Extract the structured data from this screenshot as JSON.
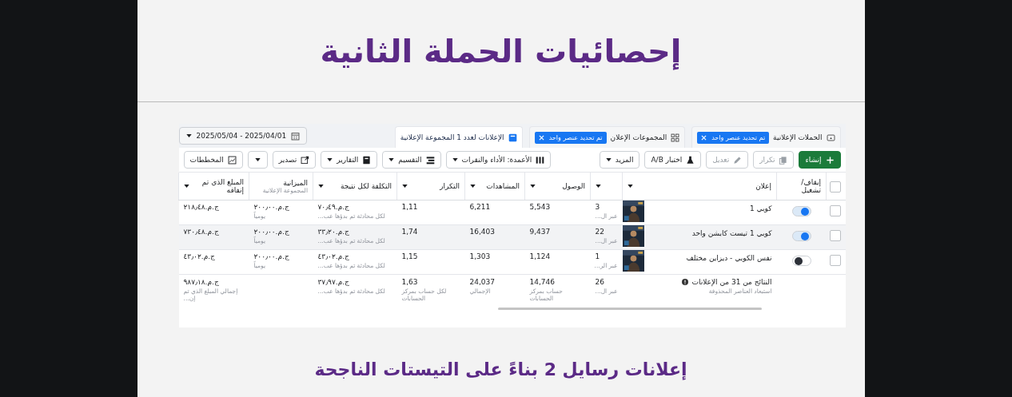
{
  "page_title": "إحصائيات الحملة الثانية",
  "tabs": [
    {
      "label": "الحملات الإعلانية",
      "selected": false,
      "chip": "تم تحديد عنصر واحد"
    },
    {
      "label": "المجموعات الإعلان",
      "selected": false,
      "chip": "تم تحديد عنصر واحد"
    },
    {
      "label": "الإعلانات لعدد 1 المجموعة الإعلانية",
      "selected": true
    }
  ],
  "date_range": "2025/05/04 - 2025/04/01",
  "toolbar": [
    {
      "label": "إنشاء",
      "kind": "primary",
      "disabled": false
    },
    {
      "label": "تكرار",
      "kind": "button",
      "disabled": true
    },
    {
      "label": "تعديل",
      "kind": "button",
      "disabled": true
    },
    {
      "label": "اختبار A/B",
      "kind": "button",
      "disabled": false
    },
    {
      "label": "المزيد",
      "kind": "dropdown",
      "disabled": false
    },
    {
      "label": "الأعمدة: الأداء والنقرات",
      "kind": "dropdown",
      "disabled": false
    },
    {
      "label": "التقسيم",
      "kind": "dropdown",
      "disabled": false
    },
    {
      "label": "التقارير",
      "kind": "dropdown",
      "disabled": false
    },
    {
      "label": "تصدير",
      "kind": "button",
      "disabled": false
    },
    {
      "kind": "caret",
      "disabled": false
    },
    {
      "label": "المخططات",
      "kind": "button",
      "disabled": false
    }
  ],
  "table": {
    "select_all_checked": false,
    "fixed_columns": [
      {
        "kind": "checkbox"
      },
      {
        "kind": "toggle",
        "label": "إيقاف/ تشغيل"
      },
      {
        "kind": "ad",
        "label": "إعلان",
        "caret": true
      }
    ],
    "columns": [
      {
        "kind": "metric",
        "caret": true
      },
      {
        "kind": "metric",
        "label": "الوصول",
        "caret": true
      },
      {
        "kind": "metric",
        "label": "المشاهدات",
        "caret": true
      },
      {
        "kind": "metric",
        "label": "التكرار",
        "caret": true
      },
      {
        "kind": "metric",
        "label": "التكلفة لكل نتيجة",
        "caret": true
      },
      {
        "kind": "metric",
        "label": "الميزانية",
        "sublabel": "المجموعة الإعلانية",
        "caret": false
      },
      {
        "kind": "metric",
        "label": "المبلغ الذي تم إنفاقه",
        "caret": true
      }
    ],
    "rows": [
      {
        "checked": false,
        "on": true,
        "hovered": false,
        "name": "كوبي 1",
        "cells": [
          {
            "value": "3",
            "note": "عبر ال..."
          },
          {
            "value": "5,543"
          },
          {
            "value": "6,211"
          },
          {
            "value": "1,11"
          },
          {
            "value": "ج.م.‏٧٠٫٤٩",
            "note": "لكل محادثة تم بدؤها عب..."
          },
          {
            "value": "ج.م.‏٢٠٠٫٠٠",
            "note": "يومياً"
          },
          {
            "value": "ج.م.‏٢١٨٫٤٨"
          }
        ]
      },
      {
        "checked": false,
        "on": true,
        "hovered": true,
        "name": "كوبي 1 تيست كابشن واحد",
        "cells": [
          {
            "value": "22",
            "note": "عبر ال..."
          },
          {
            "value": "9,437"
          },
          {
            "value": "16,403"
          },
          {
            "value": "1,74"
          },
          {
            "value": "ج.م.‏٣٣٫٢٠",
            "note": "لكل محادثة تم بدؤها عب..."
          },
          {
            "value": "ج.م.‏٢٠٠٫٠٠",
            "note": "يومياً"
          },
          {
            "value": "ج.م.‏٧٣٠٫٤٨"
          }
        ]
      },
      {
        "checked": false,
        "on": false,
        "hovered": false,
        "name": "نفس الكوبي - ديزاين مختلف",
        "cells": [
          {
            "value": "1",
            "note": "عبر الر..."
          },
          {
            "value": "1,124"
          },
          {
            "value": "1,303"
          },
          {
            "value": "1,15"
          },
          {
            "value": "ج.م.‏٤٣٫٠٢",
            "note": "لكل محادثة تم بدؤها عب..."
          },
          {
            "value": "ج.م.‏٢٠٠٫٠٠",
            "note": "يومياً"
          },
          {
            "value": "ج.م.‏٤٣٫٠٢"
          }
        ]
      }
    ],
    "summary": {
      "label": "النتائج من 31 من الإعلانات",
      "note": "استبعاد العناصر المحذوفة",
      "cells": [
        {
          "value": "26",
          "note": "عبر ال..."
        },
        {
          "value": "14,746",
          "note": "حساب بمركز الحسابات"
        },
        {
          "value": "24,037",
          "note": "الإجمالي"
        },
        {
          "value": "1,63",
          "note": "لكل حساب بمركز الحسابات"
        },
        {
          "value": "ج.م.‏٣٧٫٩٧",
          "note": "لكل محادثة تم بدؤها عب..."
        },
        null,
        {
          "value": "ج.م.‏٩٨٧٫١٨",
          "note": "إجمالي المبلغ الذي تم إن..."
        }
      ]
    }
  },
  "next_heading": "إعلانات رسايل 2 بناءً على التيستات الناجحة"
}
